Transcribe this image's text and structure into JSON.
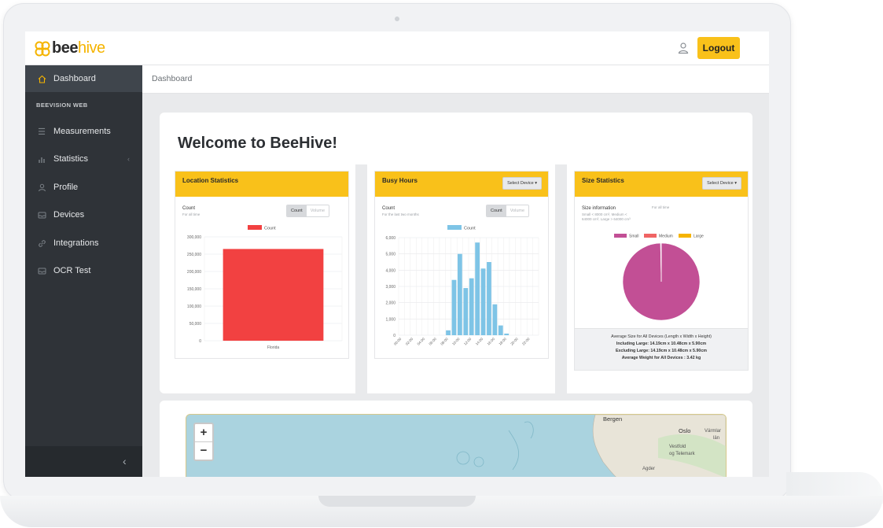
{
  "brand": {
    "bee": "bee",
    "hive": "hive"
  },
  "header": {
    "logout_label": "Logout"
  },
  "sidebar": {
    "section_header": "BEEVISION WEB",
    "items": [
      {
        "label": "Dashboard",
        "icon": "home-icon"
      },
      {
        "label": "Measurements",
        "icon": "list-icon"
      },
      {
        "label": "Statistics",
        "icon": "bar-chart-icon"
      },
      {
        "label": "Profile",
        "icon": "user-icon"
      },
      {
        "label": "Devices",
        "icon": "inbox-icon"
      },
      {
        "label": "Integrations",
        "icon": "link-icon"
      },
      {
        "label": "OCR Test",
        "icon": "inbox-icon"
      }
    ],
    "collapse_icon": "chevron-left-icon"
  },
  "breadcrumb": "Dashboard",
  "welcome_title": "Welcome to BeeHive!",
  "location_stats": {
    "title": "Location Statistics",
    "sub_title": "Count",
    "sub_note": "For all time",
    "toggle": [
      "Count",
      "Volume"
    ]
  },
  "busy_hours": {
    "title": "Busy Hours",
    "select_label": "Select Device ▾",
    "sub_title": "Count",
    "sub_note": "For the last two months",
    "toggle": [
      "Count",
      "Volume"
    ]
  },
  "size_stats": {
    "title": "Size Statistics",
    "select_label": "Select Device ▾",
    "sub_title": "Size information",
    "sub_note_1": "Small < 8000 cm³, Medium <",
    "sub_note_2": "64000 cm³, Large > 64000 cm³",
    "period": "For all time",
    "footer": {
      "line1": "Average Size for All Devices (Length x Width x Height)",
      "line2": "Including Large: 14.19cm x 10.48cm x 5.90cm",
      "line3": "Excluding Large: 14.19cm x 10.48cm x 5.90cm",
      "line4": "Average Weight for All Devices : 3.42 kg"
    }
  },
  "map": {
    "zoom_in": "+",
    "zoom_out": "−",
    "labels": [
      "Bergen",
      "Oslo",
      "Vestfold",
      "og Telemark",
      "Agder",
      "Värmlar",
      "län"
    ]
  },
  "colors": {
    "accent": "#f9c11a",
    "sidebar": "#2f3338",
    "bar_red": "#f24141",
    "bar_blue": "#7ec4e6",
    "pie_small": "#c24f95",
    "pie_medium": "#f06464",
    "pie_large": "#f5b400"
  },
  "chart_data": [
    {
      "type": "bar",
      "title": "Location Statistics",
      "legend": "Count",
      "categories": [
        "Florida"
      ],
      "series": [
        {
          "name": "Count",
          "values": [
            265000
          ]
        }
      ],
      "ylim": [
        0,
        300000
      ],
      "yticks": [
        "300,000",
        "250,000",
        "200,000",
        "150,000",
        "100,000",
        "50,000",
        "0"
      ],
      "grid": true
    },
    {
      "type": "bar",
      "title": "Busy Hours",
      "legend": "Count",
      "categories": [
        "00:00",
        "01:00",
        "02:00",
        "03:00",
        "04:00",
        "05:00",
        "06:00",
        "07:00",
        "08:00",
        "09:00",
        "10:00",
        "11:00",
        "12:00",
        "13:00",
        "14:00",
        "15:00",
        "16:00",
        "17:00",
        "18:00",
        "19:00",
        "20:00",
        "21:00",
        "22:00",
        "23:00"
      ],
      "xticks": [
        "00:00",
        "02:00",
        "04:00",
        "06:00",
        "08:00",
        "10:00",
        "12:00",
        "14:00",
        "16:00",
        "18:00",
        "20:00",
        "22:00"
      ],
      "series": [
        {
          "name": "Count",
          "values": [
            0,
            0,
            0,
            0,
            0,
            0,
            0,
            0,
            300,
            3400,
            5000,
            2900,
            3500,
            5700,
            4100,
            4500,
            1900,
            600,
            100,
            0,
            0,
            0,
            0,
            0
          ]
        }
      ],
      "ylim": [
        0,
        6000
      ],
      "yticks": [
        "6,000",
        "5,000",
        "4,000",
        "3,000",
        "2,000",
        "1,000",
        "0"
      ],
      "grid": true
    },
    {
      "type": "pie",
      "title": "Size Statistics",
      "legend": [
        "Small",
        "Medium",
        "Large"
      ],
      "values": [
        99.7,
        0.2,
        0.1
      ]
    }
  ]
}
